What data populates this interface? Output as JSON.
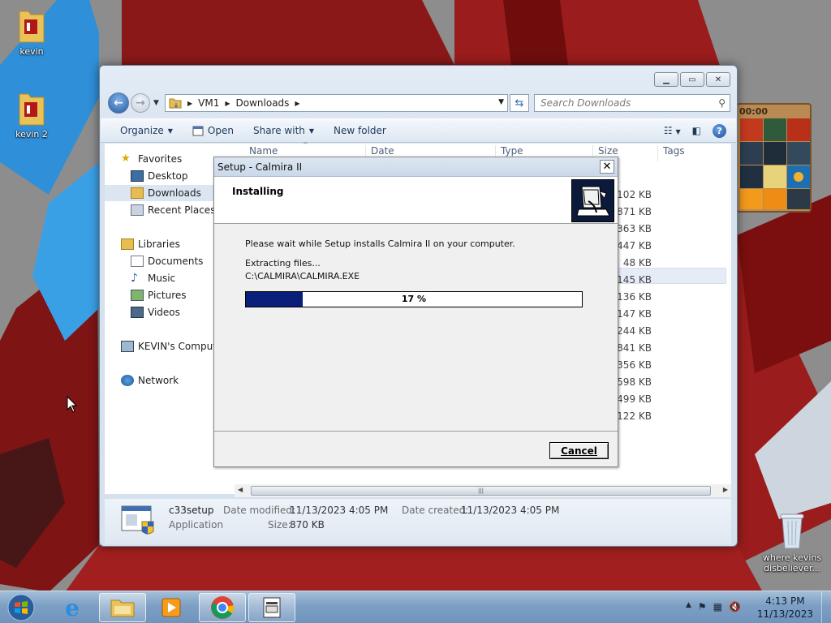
{
  "desktop": {
    "icons": [
      {
        "label": "kevin"
      },
      {
        "label": "kevin 2"
      }
    ],
    "recycle_bin_label": "where kevins disbeliever..."
  },
  "explorer": {
    "breadcrumb": [
      "VM1",
      "Downloads"
    ],
    "search_placeholder": "Search Downloads",
    "toolbar": {
      "organize": "Organize",
      "open": "Open",
      "share_with": "Share with",
      "new_folder": "New folder"
    },
    "nav": {
      "favorites": "Favorites",
      "desktop": "Desktop",
      "downloads": "Downloads",
      "recent_places": "Recent Places",
      "libraries": "Libraries",
      "documents": "Documents",
      "music": "Music",
      "pictures": "Pictures",
      "videos": "Videos",
      "computer": "KEVIN's Computer",
      "network": "Network"
    },
    "columns": {
      "name": "Name",
      "date": "Date",
      "type": "Type",
      "size": "Size",
      "tags": "Tags"
    },
    "sizes": [
      "102 KB",
      "871 KB",
      "363 KB",
      "447 KB",
      "48 KB",
      "145 KB",
      "136 KB",
      "147 KB",
      ",244 KB",
      "841 KB",
      ",356 KB",
      ",598 KB",
      ",499 KB",
      ",122 KB"
    ],
    "details": {
      "file_name": "c33setup",
      "file_type": "Application",
      "date_modified_label": "Date modified:",
      "date_modified": "11/13/2023 4:05 PM",
      "date_created_label": "Date created:",
      "date_created": "11/13/2023 4:05 PM",
      "size_label": "Size:",
      "size": "870 KB"
    }
  },
  "setup": {
    "title": "Setup - Calmira II",
    "close": "✕",
    "heading": "Installing",
    "message": "Please wait while Setup installs Calmira II on your computer.",
    "status": "Extracting files...",
    "current_file": "C:\\CALMIRA\\CALMIRA.EXE",
    "progress_percent": 17,
    "progress_label": "17 %",
    "cancel_label": "Cancel"
  },
  "gadget": {
    "time": "00:00"
  },
  "taskbar": {
    "time": "4:13 PM",
    "date": "11/13/2023"
  },
  "colors": {
    "progress_fill": "#0a1f7a",
    "title_bar": "#cbd8e8",
    "taskbar": "#7d9fc4"
  }
}
